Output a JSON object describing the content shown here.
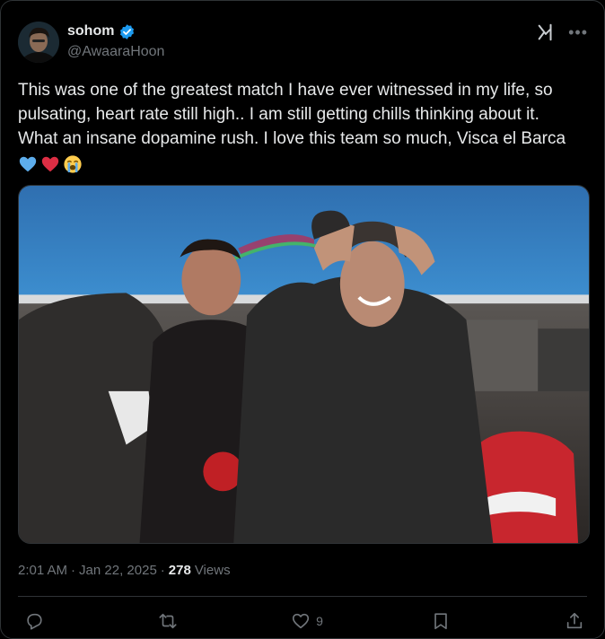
{
  "author": {
    "display_name": "sohom",
    "handle": "@AwaaraHoon",
    "verified": true,
    "verified_color": "#1d9bf0"
  },
  "tweet": {
    "text": "This was one of the greatest match I have ever witnessed in my life, so pulsating, heart rate still high.. I am still getting chills thinking about it. What an insane dopamine rush. I love this team so much, Visca el Barca ",
    "emojis": [
      "blue-heart-icon",
      "red-heart-icon",
      "loudly-crying-face-icon"
    ]
  },
  "meta": {
    "time": "2:01 AM",
    "separator": "·",
    "date": "Jan 22, 2025",
    "views_count": "278",
    "views_label": "Views"
  },
  "actions": {
    "reply_count": "",
    "retweet_count": "",
    "like_count": "9",
    "bookmark_count": ""
  },
  "colors": {
    "background": "#000000",
    "text": "#e7e9ea",
    "muted": "#71767b",
    "border": "#2f3336"
  },
  "icons": {
    "grok": "grok-icon",
    "more": "more-icon",
    "reply": "reply-icon",
    "retweet": "retweet-icon",
    "like": "heart-icon",
    "bookmark": "bookmark-icon",
    "share": "share-icon"
  }
}
